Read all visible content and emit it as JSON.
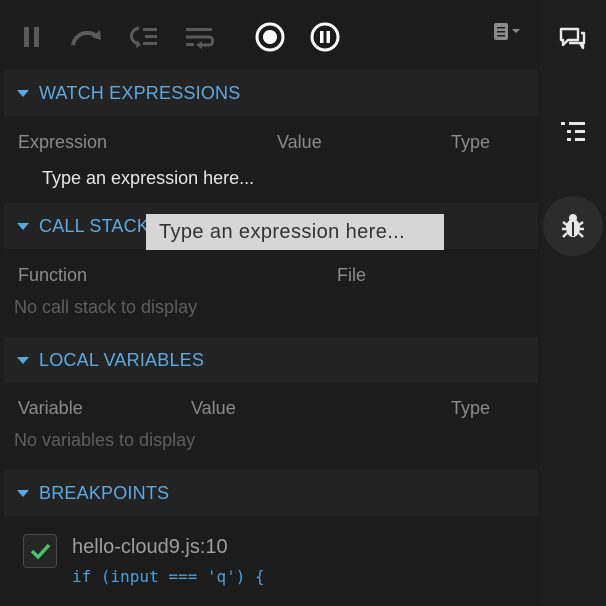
{
  "toolbar": {
    "buttons": [
      "pause-icon",
      "step-over-icon",
      "step-into-icon",
      "step-out-icon",
      "record-icon",
      "pause-circle-icon",
      "panel-menu-icon"
    ]
  },
  "watch": {
    "title": "WATCH EXPRESSIONS",
    "columns": [
      "Expression",
      "Value",
      "Type"
    ],
    "input_placeholder": "Type an expression here..."
  },
  "tooltip": "Type an expression here...",
  "call_stack": {
    "title": "CALL STACK",
    "columns": [
      "Function",
      "File"
    ],
    "empty": "No call stack to display"
  },
  "locals": {
    "title": "LOCAL VARIABLES",
    "columns": [
      "Variable",
      "Value",
      "Type"
    ],
    "empty": "No variables to display"
  },
  "breakpoints": {
    "title": "BREAKPOINTS",
    "items": [
      {
        "file": "hello-cloud9.js:10",
        "code": "if (input === 'q') {",
        "checked": true
      }
    ]
  },
  "sidebar": {
    "icons": [
      "chat-icon",
      "outline-icon",
      "debugger-icon"
    ],
    "active": "debugger-icon"
  },
  "colors": {
    "accent": "#5ea9e0",
    "check": "#4cc36a",
    "panel_bg": "#1c1c1c"
  }
}
